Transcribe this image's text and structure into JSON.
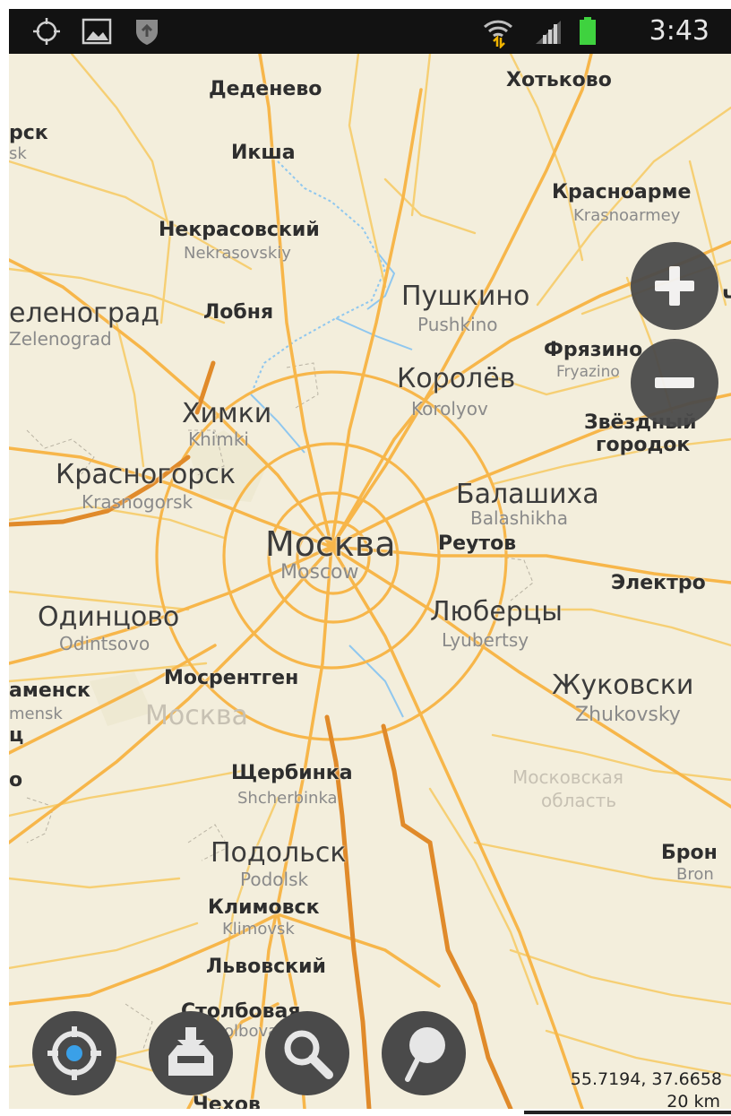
{
  "status_bar": {
    "time": "3:43",
    "icons": [
      "gps-icon",
      "picture-icon",
      "shield-icon",
      "wifi-icon",
      "signal-icon",
      "battery-icon"
    ]
  },
  "map": {
    "labels": {
      "dedenevo": "Деденево",
      "khotkovo": "Хотьково",
      "rsk": "рск",
      "rsk_en": "sk",
      "iksha": "Икша",
      "krasnoarme": "Красноарме",
      "krasnoarme_en": "Krasnoarmey",
      "nekrasovsky": "Некрасовский",
      "nekrasovsky_en": "Nekrasovskiy",
      "zelenograd": "еленоград",
      "zelenograd_en": "Zelenograd",
      "lobnya": "Лобня",
      "pushkino": "Пушкино",
      "pushkino_en": "Pushkino",
      "fryazino": "Фрязино",
      "fryazino_en": "Fryazino",
      "korolev": "Королёв",
      "korolev_en": "Korolyov",
      "khimki": "Химки",
      "khimki_en": "Khimki",
      "zvezdny": "Звёздный",
      "gorodok": "городок",
      "krasnogorsk": "Красногорск",
      "krasnogorsk_en": "Krasnogorsk",
      "balashikha": "Балашиха",
      "balashikha_en": "Balashikha",
      "moskva": "Москва",
      "moscow_en": "Moscow",
      "reutov": "Реутов",
      "elektro": "Электро",
      "odintsovo": "Одинцово",
      "odintsovo_en": "Odintsovo",
      "lyubertsy": "Люберцы",
      "lyubertsy_en": "Lyubertsy",
      "mosrentgen": "Мосрентген",
      "amensk": "аменск",
      "amensk_en": "mensk",
      "ts": "ц",
      "moskva_region": "Москва",
      "zhukovsky": "Жуковски",
      "zhukovsky_en": "Zhukovsky",
      "o": "о",
      "shcherbinka": "Щербинка",
      "shcherbinka_en": "Shcherbinka",
      "moskovskaya": "Московская",
      "oblast": "область",
      "podolsk": "Подольск",
      "podolsk_en": "Podolsk",
      "bron": "Брон",
      "bron_en": "Bron",
      "klimovsk": "Климовск",
      "klimovsk_en": "Klimovsk",
      "lvovsky": "Львовский",
      "stolbovaya": "Столбовая",
      "stolbovaya_en": "olbovaya",
      "chekhov": "Чехов",
      "ch": "Ч"
    },
    "coordinates": "55.7194, 37.6658",
    "scale": "20 km",
    "controls": {
      "zoom_in": "zoom-in-icon",
      "zoom_out": "zoom-out-icon"
    },
    "toolbar": [
      "my-location-icon",
      "download-icon",
      "search-icon",
      "bookmark-pin-icon"
    ],
    "colors": {
      "land": "#f3eedc",
      "road_major": "#f7b64a",
      "road_minor": "#f6cf74",
      "highway": "#e08a2a",
      "water": "#8fc7ef",
      "button": "#4a4a4a"
    }
  }
}
